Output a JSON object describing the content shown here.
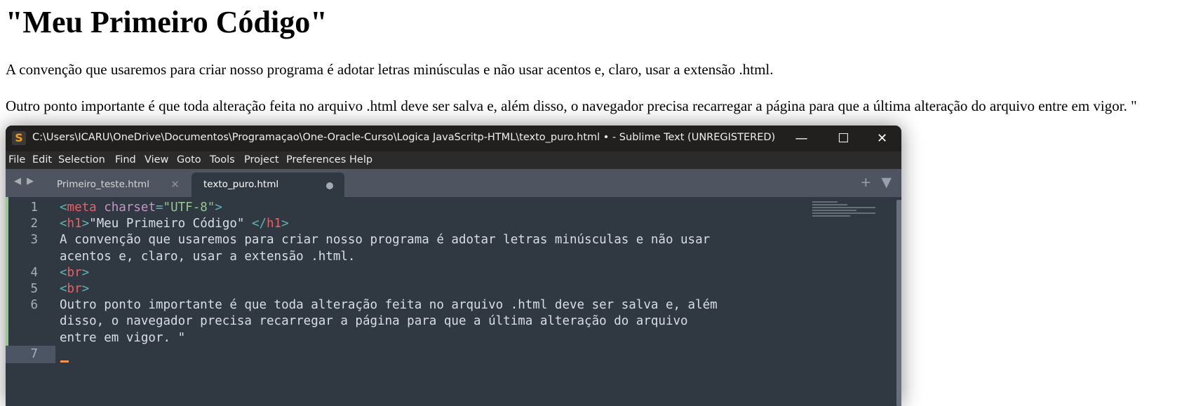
{
  "page": {
    "heading": "\"Meu Primeiro Código\"",
    "paragraphs": [
      "A convenção que usaremos para criar nosso programa é adotar letras minúsculas e não usar acentos e, claro, usar a extensão .html.",
      "Outro ponto importante é que toda alteração feita no arquivo .html deve ser salva e, além disso, o navegador precisa recarregar a página para que a última alteração do arquivo entre em vigor. \""
    ]
  },
  "window": {
    "title": "C:\\Users\\ICARU\\OneDrive\\Documentos\\Programaçao\\One-Oracle-Curso\\Logica JavaScritp-HTML\\texto_puro.html • - Sublime Text (UNREGISTERED)",
    "app_icon": "S",
    "controls": {
      "minimize": "—",
      "maximize": "☐",
      "close": "✕"
    }
  },
  "menu": [
    "File",
    "Edit",
    "Selection",
    "Find",
    "View",
    "Goto",
    "Tools",
    "Project",
    "Preferences",
    "Help"
  ],
  "tabs": {
    "nav": "◀ ▶",
    "items": [
      {
        "label": "Primeiro_teste.html",
        "state": "inactive",
        "close": "✕"
      },
      {
        "label": "texto_puro.html",
        "state": "active",
        "dirty": true
      }
    ],
    "add": "+",
    "menu": "▼"
  },
  "editor": {
    "lines": [
      {
        "n": "1",
        "parts": [
          [
            "t-tag",
            "<"
          ],
          [
            "t-name",
            "meta"
          ],
          [
            "",
            ""
          ],
          [
            "t-attr",
            " charset"
          ],
          [
            "t-op",
            "="
          ],
          [
            "t-str",
            "\"UTF-8\""
          ],
          [
            "t-tag",
            ">"
          ]
        ]
      },
      {
        "n": "2",
        "parts": [
          [
            "t-tag",
            "<"
          ],
          [
            "t-name",
            "h1"
          ],
          [
            "t-tag",
            ">"
          ],
          [
            "",
            "\"Meu Primeiro Código\" "
          ],
          [
            "t-tag",
            "</"
          ],
          [
            "t-name",
            "h1"
          ],
          [
            "t-tag",
            ">"
          ]
        ]
      },
      {
        "n": "3",
        "parts": [
          [
            "",
            "A convenção que usaremos para criar nosso programa é adotar letras minúsculas e não usar"
          ]
        ]
      },
      {
        "n": "",
        "parts": [
          [
            "",
            "acentos e, claro, usar a extensão .html."
          ]
        ]
      },
      {
        "n": "4",
        "parts": [
          [
            "t-tag",
            "<"
          ],
          [
            "t-name",
            "br"
          ],
          [
            "t-tag",
            ">"
          ]
        ]
      },
      {
        "n": "5",
        "parts": [
          [
            "t-tag",
            "<"
          ],
          [
            "t-name",
            "br"
          ],
          [
            "t-tag",
            ">"
          ]
        ]
      },
      {
        "n": "6",
        "parts": [
          [
            "",
            "Outro ponto importante é que toda alteração feita no arquivo .html deve ser salva e, além"
          ]
        ]
      },
      {
        "n": "",
        "parts": [
          [
            "",
            "disso, o navegador precisa recarregar a página para que a última alteração do arquivo"
          ]
        ]
      },
      {
        "n": "",
        "parts": [
          [
            "",
            "entre em vigor. \""
          ]
        ]
      },
      {
        "n": "7",
        "parts": [],
        "current": true
      }
    ]
  }
}
